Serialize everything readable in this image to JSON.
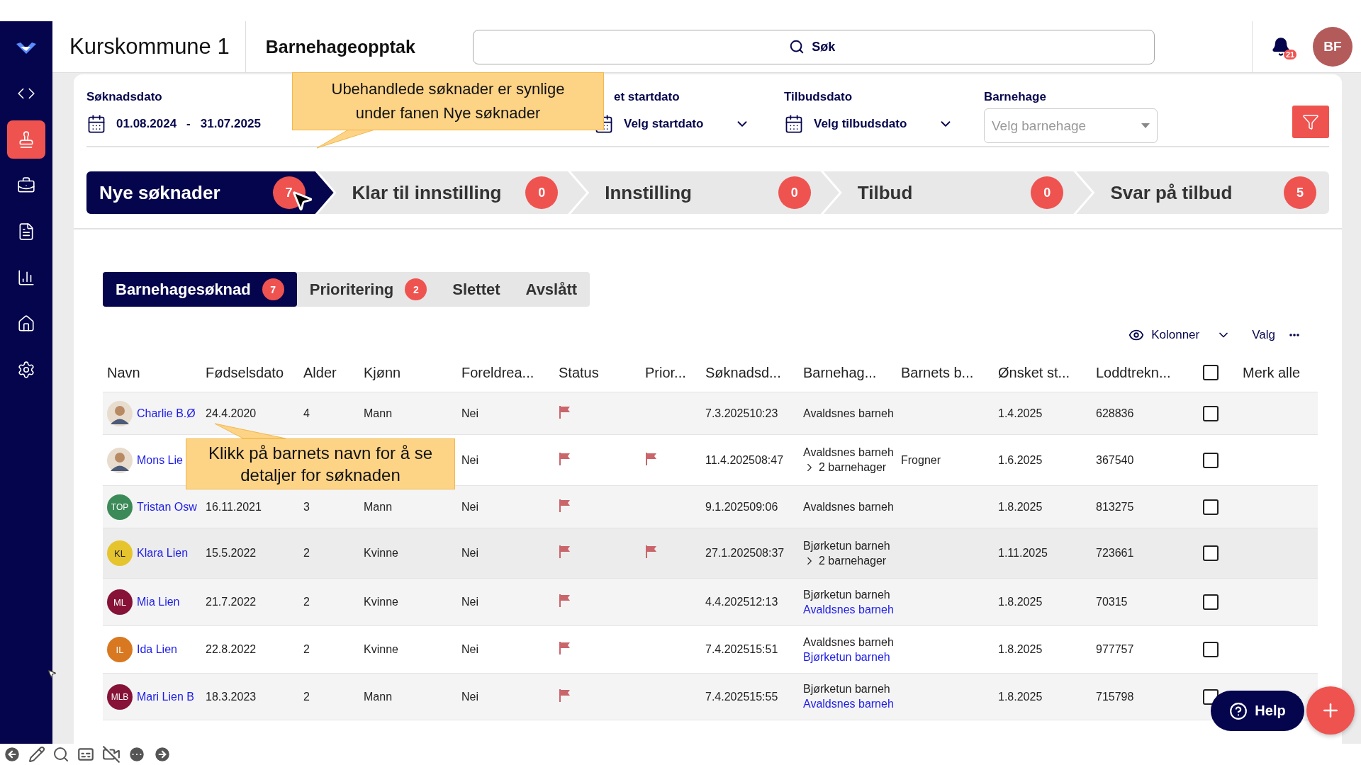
{
  "app": {
    "title": "Kurskommune 1",
    "module": "Barnehageopptak",
    "search": {
      "placeholder": "Søk"
    },
    "notifications": "21",
    "user_initials": "BF"
  },
  "sidebar": {
    "items": [
      {
        "selected": false
      },
      {
        "selected": true
      },
      {
        "selected": false
      },
      {
        "selected": false
      },
      {
        "selected": false
      },
      {
        "selected": false
      },
      {
        "selected": false
      }
    ]
  },
  "filters": [
    {
      "kind": "range",
      "label": "Søknadsdato",
      "from": "01.08.2024",
      "separator": "-",
      "to": "31.07.2025"
    },
    {
      "kind": "date",
      "label": "et startdato",
      "value": "Velg startdato"
    },
    {
      "kind": "date",
      "label": "Tilbudsdato",
      "value": "Velg tilbudsdato"
    },
    {
      "kind": "select",
      "label": "Barnehage",
      "placeholder": "Velg barnehage"
    }
  ],
  "callouts": [
    {
      "text": "Ubehandlede søknader er synlige under fanen Nye søknader"
    },
    {
      "text": "Klikk på barnets navn for å se detaljer for søknaden"
    }
  ],
  "stages": [
    {
      "label": "Nye søknader",
      "count": "7",
      "selected": true
    },
    {
      "label": "Klar til innstilling",
      "count": "0",
      "selected": false
    },
    {
      "label": "Innstilling",
      "count": "0",
      "selected": false
    },
    {
      "label": "Tilbud",
      "count": "0",
      "selected": false
    },
    {
      "label": "Svar på tilbud",
      "count": "5",
      "selected": false
    }
  ],
  "subtabs": [
    {
      "label": "Barnehagesøknad",
      "count": "7",
      "selected": true
    },
    {
      "label": "Prioritering",
      "count": "2",
      "selected": false
    },
    {
      "label": "Slettet",
      "selected": false
    },
    {
      "label": "Avslått",
      "selected": false
    }
  ],
  "table_toolbar": {
    "columns_button": "Kolonner",
    "options_button": "Valg"
  },
  "table": {
    "columns": [
      "Navn",
      "Fødselsdato",
      "Alder",
      "Kjønn",
      "Foreldrea...",
      "Status",
      "Prior...",
      "Søknadsd...",
      "Barnehag...",
      "Barnets b...",
      "Ønsket st...",
      "Loddtrekn..."
    ],
    "select_all": {
      "label": "Merk alle",
      "checked": false
    },
    "rows": [
      {
        "name": "Charlie B.Ø",
        "avatar": {
          "kind": "photo"
        },
        "birth": "24.4.2020",
        "age": "4",
        "gender": "Mann",
        "parent": "Nei",
        "status_flag": true,
        "priority_flag": false,
        "applied": "7.3.202510:23",
        "kindergarten": "Avaldsnes barneh",
        "district": "",
        "start": "1.4.2025",
        "lottery": "628836",
        "checked": false
      },
      {
        "name": "Mons Lie",
        "avatar": {
          "kind": "photo"
        },
        "birth": "",
        "age": "",
        "gender": "",
        "parent": "Nei",
        "status_flag": true,
        "priority_flag": true,
        "applied": "11.4.202508:47",
        "kindergarten": "Avaldsnes barneh",
        "more": {
          "kind": "expand",
          "text": "2 barnehager"
        },
        "district": "Frogner",
        "start": "1.6.2025",
        "lottery": "367540",
        "checked": false
      },
      {
        "name": "Tristan Osw",
        "avatar": {
          "kind": "initials",
          "initials": "TOP",
          "color": "#3b8a57"
        },
        "birth": "16.11.2021",
        "age": "3",
        "gender": "Mann",
        "parent": "Nei",
        "status_flag": true,
        "priority_flag": false,
        "applied": "9.1.202509:06",
        "kindergarten": "Avaldsnes barneh",
        "district": "",
        "start": "1.8.2025",
        "lottery": "813275",
        "checked": false
      },
      {
        "name": "Klara Lien",
        "avatar": {
          "kind": "initials",
          "initials": "KL",
          "color": "#e5c42e"
        },
        "birth": "15.5.2022",
        "age": "2",
        "gender": "Kvinne",
        "parent": "Nei",
        "status_flag": true,
        "priority_flag": true,
        "applied": "27.1.202508:37",
        "kindergarten": "Bjørketun barneh",
        "more": {
          "kind": "expand",
          "text": "2 barnehager"
        },
        "district": "",
        "start": "1.11.2025",
        "lottery": "723661",
        "checked": false
      },
      {
        "name": "Mia Lien",
        "avatar": {
          "kind": "initials",
          "initials": "ML",
          "color": "#861237"
        },
        "birth": "21.7.2022",
        "age": "2",
        "gender": "Kvinne",
        "parent": "Nei",
        "status_flag": true,
        "priority_flag": false,
        "applied": "4.4.202512:13",
        "kindergarten": "Bjørketun barneh",
        "more": {
          "kind": "link",
          "text": "Avaldsnes barneh"
        },
        "district": "",
        "start": "1.8.2025",
        "lottery": "70315",
        "checked": false
      },
      {
        "name": "Ida Lien",
        "avatar": {
          "kind": "initials",
          "initials": "IL",
          "color": "#d87820"
        },
        "birth": "22.8.2022",
        "age": "2",
        "gender": "Kvinne",
        "parent": "Nei",
        "status_flag": true,
        "priority_flag": false,
        "applied": "7.4.202515:51",
        "kindergarten": "Avaldsnes barneh",
        "more": {
          "kind": "link",
          "text": "Bjørketun barneh"
        },
        "district": "",
        "start": "1.8.2025",
        "lottery": "977757",
        "checked": false
      },
      {
        "name": "Mari Lien B",
        "avatar": {
          "kind": "initials",
          "initials": "MLB",
          "color": "#861237"
        },
        "birth": "18.3.2023",
        "age": "2",
        "gender": "Mann",
        "parent": "Nei",
        "status_flag": true,
        "priority_flag": false,
        "applied": "7.4.202515:55",
        "kindergarten": "Bjørketun barneh",
        "more": {
          "kind": "link",
          "text": "Avaldsnes barneh"
        },
        "district": "",
        "start": "1.8.2025",
        "lottery": "715798",
        "checked": false
      }
    ]
  },
  "help_button": "Help"
}
